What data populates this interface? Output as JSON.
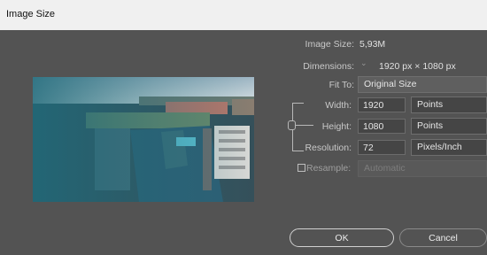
{
  "window": {
    "title": "Image Size"
  },
  "info": {
    "image_size_label": "Image Size:",
    "image_size_value": "5,93M",
    "dimensions_label": "Dimensions:",
    "dimensions_value": "1920 px  ×  1080 px"
  },
  "fit_to": {
    "label": "Fit To:",
    "value": "Original Size"
  },
  "width": {
    "label": "Width:",
    "value": "1920",
    "unit": "Points"
  },
  "height": {
    "label": "Height:",
    "value": "1080",
    "unit": "Points"
  },
  "resolution": {
    "label": "Resolution:",
    "value": "72",
    "unit": "Pixels/Inch"
  },
  "resample": {
    "label": "Resample:",
    "value": "Automatic",
    "checked": false
  },
  "buttons": {
    "ok": "OK",
    "cancel": "Cancel"
  },
  "colors": {
    "dialog_bg": "#535353",
    "titlebar_bg": "#f0f0f0",
    "field_bg": "#454545"
  }
}
